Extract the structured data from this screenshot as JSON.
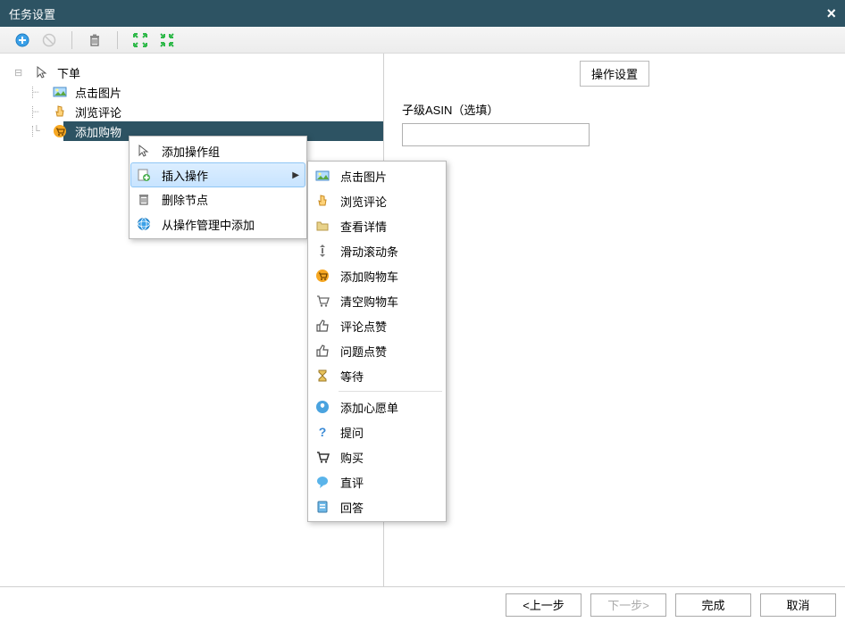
{
  "title": "任务设置",
  "toolbar": {
    "add": "add",
    "disabled": "disabled",
    "delete": "delete",
    "expand": "expand",
    "collapse": "collapse"
  },
  "tree": {
    "root": {
      "label": "下单"
    },
    "children": [
      {
        "label": "点击图片"
      },
      {
        "label": "浏览评论"
      },
      {
        "label": "添加购物"
      }
    ]
  },
  "context_menu": {
    "items": [
      {
        "label": "添加操作组",
        "icon": "cursor"
      },
      {
        "label": "插入操作",
        "icon": "insert",
        "submenu": true,
        "highlighted": true
      },
      {
        "label": "删除节点",
        "icon": "trash"
      },
      {
        "label": "从操作管理中添加",
        "icon": "globe"
      }
    ],
    "submenu": [
      {
        "label": "点击图片",
        "icon": "image"
      },
      {
        "label": "浏览评论",
        "icon": "pointer"
      },
      {
        "label": "查看详情",
        "icon": "folder"
      },
      {
        "label": "滑动滚动条",
        "icon": "scroll"
      },
      {
        "label": "添加购物车",
        "icon": "cart-add"
      },
      {
        "label": "清空购物车",
        "icon": "cart-empty"
      },
      {
        "label": "评论点赞",
        "icon": "thumb"
      },
      {
        "label": "问题点赞",
        "icon": "thumb"
      },
      {
        "label": "等待",
        "icon": "hourglass"
      },
      {
        "sep": true
      },
      {
        "label": "添加心愿单",
        "icon": "wish"
      },
      {
        "label": "提问",
        "icon": "question"
      },
      {
        "label": "购买",
        "icon": "buy"
      },
      {
        "label": "直评",
        "icon": "chat"
      },
      {
        "label": "回答",
        "icon": "answer"
      }
    ]
  },
  "right_panel": {
    "tab": "操作设置",
    "field_label": "子级ASIN（选填）",
    "field_value": ""
  },
  "buttons": {
    "prev": "<上一步",
    "next": "下一步>",
    "finish": "完成",
    "cancel": "取消"
  }
}
